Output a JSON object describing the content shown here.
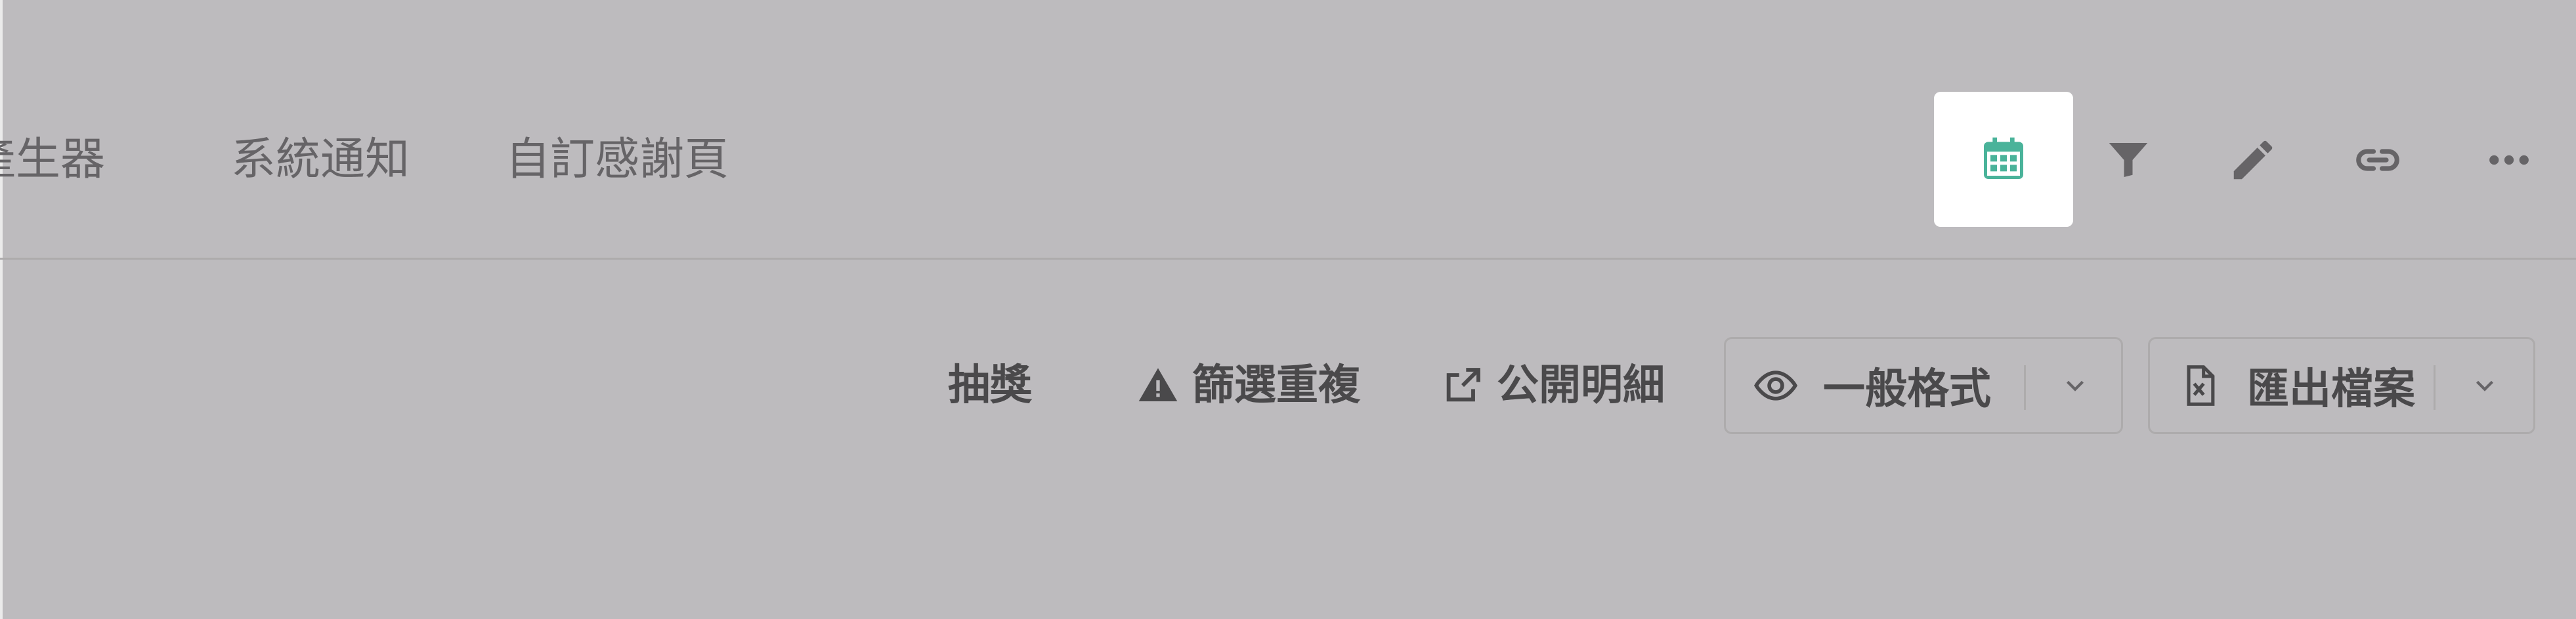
{
  "nav": {
    "tabs": [
      {
        "label": "產生器"
      },
      {
        "label": "系統通知"
      },
      {
        "label": "自訂感謝頁"
      }
    ]
  },
  "header_tools": {
    "calendar_icon": "calendar-icon",
    "filter_icon": "filter-icon",
    "edit_icon": "pencil-icon",
    "link_icon": "link-icon",
    "more_icon": "more-icon"
  },
  "toolbar": {
    "lottery_label": "抽獎",
    "filter_duplicates_label": "篩選重複",
    "public_details_label": "公開明細",
    "view_format_label": "一般格式",
    "export_label": "匯出檔案"
  },
  "colors": {
    "overlay_background": "#bdbbbe",
    "calendar_accent": "#4ab39a",
    "highlight_background": "#ffffff",
    "text_muted": "#666467",
    "text_strong": "#4a494b"
  }
}
